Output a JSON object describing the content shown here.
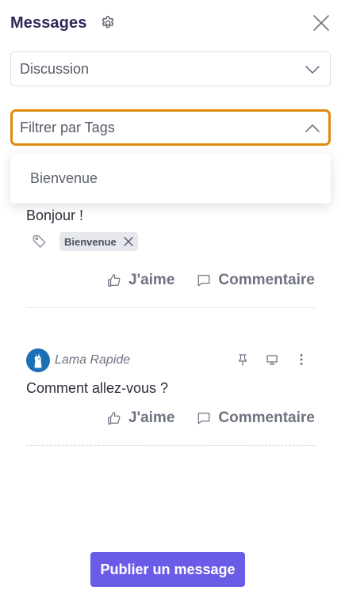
{
  "header": {
    "title": "Messages",
    "settings_icon": "gear-icon",
    "close_icon": "close-icon"
  },
  "discussion_select": {
    "value": "Discussion",
    "icon": "chevron-down-icon"
  },
  "tag_filter": {
    "placeholder": "Filtrer par Tags",
    "icon": "chevron-up-icon",
    "focused_border_color": "#e08a0c",
    "options": [
      "Bienvenue"
    ]
  },
  "posts": [
    {
      "text": "Bonjour !",
      "tags": [
        "Bienvenue"
      ],
      "like_label": "J'aime",
      "comment_label": "Commentaire"
    },
    {
      "author": "Lama Rapide",
      "text": "Comment allez-vous ?",
      "like_label": "J'aime",
      "comment_label": "Commentaire"
    }
  ],
  "publish_button": {
    "label": "Publier un message",
    "color": "#6b5ce7"
  }
}
